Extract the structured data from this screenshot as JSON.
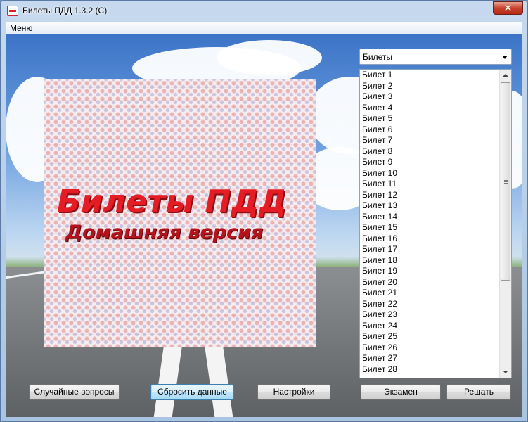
{
  "window": {
    "title": "Билеты ПДД 1.3.2 (C)",
    "close_label": "✕"
  },
  "menu": {
    "items": [
      "Меню"
    ]
  },
  "logo": {
    "title": "Билеты ПДД",
    "subtitle": "Домашняя версия"
  },
  "combo": {
    "selected": "Билеты"
  },
  "tickets": [
    "Билет 1",
    "Билет 2",
    "Билет 3",
    "Билет 4",
    "Билет 5",
    "Билет 6",
    "Билет 7",
    "Билет 8",
    "Билет 9",
    "Билет 10",
    "Билет 11",
    "Билет 12",
    "Билет 13",
    "Билет 14",
    "Билет 15",
    "Билет 16",
    "Билет 17",
    "Билет 18",
    "Билет 19",
    "Билет 20",
    "Билет 21",
    "Билет 22",
    "Билет 23",
    "Билет 24",
    "Билет 25",
    "Билет 26",
    "Билет 27",
    "Билет 28"
  ],
  "buttons": {
    "random": "Случайные вопросы",
    "reset": "Сбросить данные",
    "settings": "Настройки",
    "exam": "Экзамен",
    "solve": "Решать"
  },
  "colors": {
    "logo_red": "#e51c23",
    "logo_dark_red": "#b5121b",
    "close_red": "#c7422c"
  }
}
